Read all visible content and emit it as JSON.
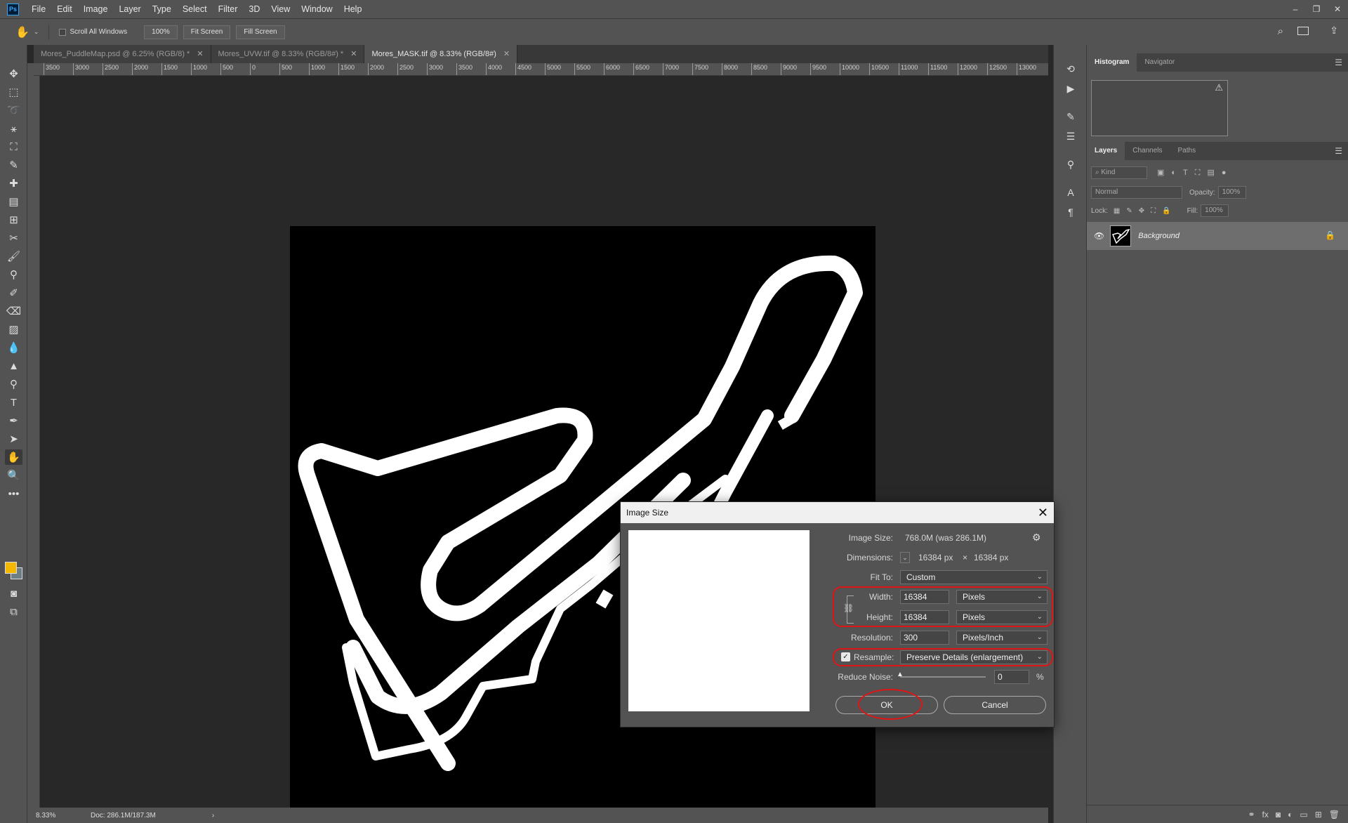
{
  "app": {
    "logo": "Ps",
    "menu": [
      "File",
      "Edit",
      "Image",
      "Layer",
      "Type",
      "Select",
      "Filter",
      "3D",
      "View",
      "Window",
      "Help"
    ],
    "window_controls": [
      "–",
      "❐",
      "✕"
    ]
  },
  "options_bar": {
    "scroll_all_windows": "Scroll All Windows",
    "zoom_100": "100%",
    "fit_screen": "Fit Screen",
    "fill_screen": "Fill Screen"
  },
  "tabs": [
    {
      "label": "Mores_PuddleMap.psd @ 6.25% (RGB/8) *",
      "active": false
    },
    {
      "label": "Mores_UVW.tif @ 8.33% (RGB/8#) *",
      "active": false
    },
    {
      "label": "Mores_MASK.tif @ 8.33% (RGB/8#)",
      "active": true
    }
  ],
  "ruler_top": [
    "3500",
    "3000",
    "2500",
    "2000",
    "1500",
    "1000",
    "500",
    "0",
    "500",
    "1000",
    "1500",
    "2000",
    "2500",
    "3000",
    "3500",
    "4000",
    "4500",
    "5000",
    "5500",
    "6000",
    "6500",
    "7000",
    "7500",
    "8000",
    "8500",
    "9000",
    "9500",
    "10000",
    "10500",
    "11000",
    "11500",
    "12000",
    "12500",
    "13000"
  ],
  "status": {
    "zoom": "8.33%",
    "doc": "Doc: 286.1M/187.3M",
    "arrow": "›"
  },
  "panels": {
    "top_tabs": [
      "Histogram",
      "Navigator"
    ],
    "layer_tabs": [
      "Layers",
      "Channels",
      "Paths"
    ],
    "kind_label": "Kind",
    "blend_mode": "Normal",
    "opacity_label": "Opacity:",
    "opacity_value": "100%",
    "lock_label": "Lock:",
    "fill_label": "Fill:",
    "fill_value": "100%",
    "layer_name": "Background"
  },
  "dialog": {
    "title": "Image Size",
    "image_size_label": "Image Size:",
    "image_size_value": "768.0M (was 286.1M)",
    "dimensions_label": "Dimensions:",
    "dim_w": "16384 px",
    "dim_x": "×",
    "dim_h": "16384 px",
    "fit_to_label": "Fit To:",
    "fit_to_value": "Custom",
    "width_label": "Width:",
    "width_value": "16384",
    "width_unit": "Pixels",
    "height_label": "Height:",
    "height_value": "16384",
    "height_unit": "Pixels",
    "resolution_label": "Resolution:",
    "resolution_value": "300",
    "resolution_unit": "Pixels/Inch",
    "resample_label": "Resample:",
    "resample_value": "Preserve Details (enlargement)",
    "reduce_noise_label": "Reduce Noise:",
    "reduce_noise_value": "0",
    "reduce_noise_unit": "%",
    "ok": "OK",
    "cancel": "Cancel"
  },
  "colors": {
    "foreground": "#f5b800",
    "background": "#6d7e86",
    "annotation": "#e01414"
  }
}
